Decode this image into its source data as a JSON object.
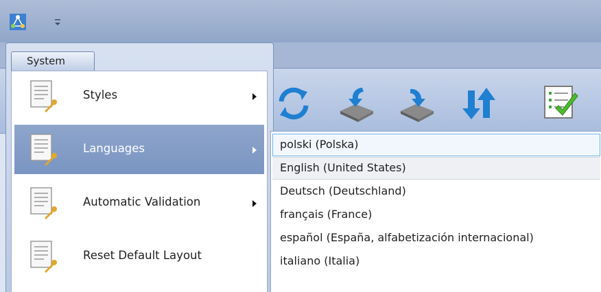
{
  "colors": {
    "highlight": "#7a95c2",
    "hover_border": "#6fb2e5",
    "ribbon": "#b7c8e4"
  },
  "titlebar": {
    "app_icon": "network-graph-icon",
    "qat_icon": "customize-quick-access-icon"
  },
  "system_menu": {
    "tab_label": "System",
    "items": [
      {
        "label": "Styles",
        "icon": "document-wrench-icon",
        "has_submenu": true,
        "highlighted": false
      },
      {
        "label": "Languages",
        "icon": "document-wrench-icon",
        "has_submenu": true,
        "highlighted": true
      },
      {
        "label": "Automatic Validation",
        "icon": "document-wrench-icon",
        "has_submenu": true,
        "highlighted": false
      },
      {
        "label": "Reset Default Layout",
        "icon": "document-wrench-icon",
        "has_submenu": false,
        "highlighted": false
      }
    ]
  },
  "ribbon": {
    "buttons": [
      {
        "icon": "refresh-icon"
      },
      {
        "icon": "import-icon"
      },
      {
        "icon": "export-icon"
      },
      {
        "icon": "sort-icon"
      },
      {
        "icon": "validate-checklist-icon"
      }
    ]
  },
  "languages_menu": {
    "items": [
      {
        "label": "polski (Polska)",
        "state": "hover"
      },
      {
        "label": "English (United States)",
        "state": "selected"
      },
      {
        "label": "Deutsch (Deutschland)",
        "state": ""
      },
      {
        "label": "français (France)",
        "state": ""
      },
      {
        "label": "español (España, alfabetización internacional)",
        "state": ""
      },
      {
        "label": "italiano (Italia)",
        "state": ""
      }
    ]
  }
}
